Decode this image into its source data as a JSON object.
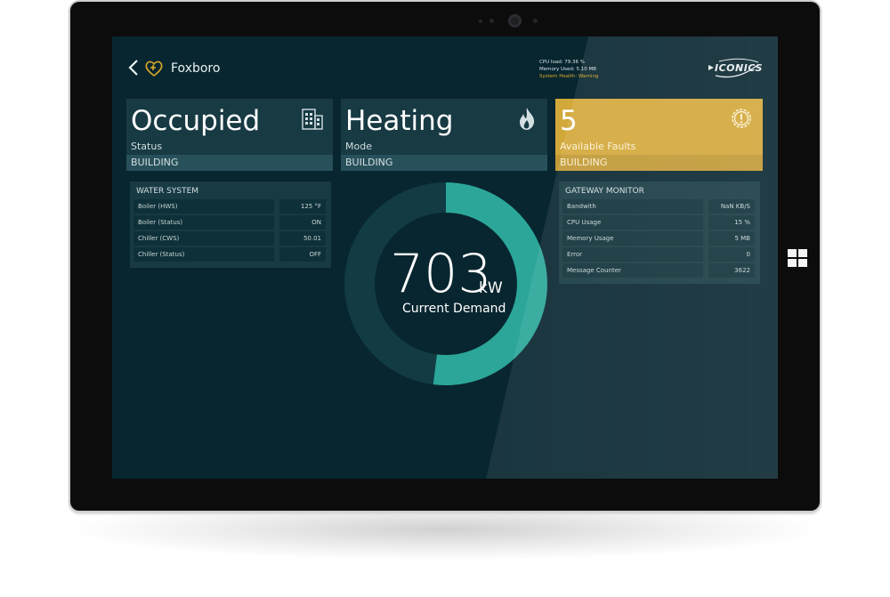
{
  "app": {
    "site": "Foxboro",
    "logo_text": "ICONICS"
  },
  "system_status": {
    "cpu_load": "CPU load: 79.36 %",
    "memory_used": "Memory Used: 5.10 MB",
    "health": "System Health: Warning"
  },
  "cards": [
    {
      "value": "Occupied",
      "label": "Status",
      "tag": "BUILDING",
      "icon": "building-icon"
    },
    {
      "value": "Heating",
      "label": "Mode",
      "tag": "BUILDING",
      "icon": "flame-icon"
    },
    {
      "value": "5",
      "label": "Available Faults",
      "tag": "BUILDING",
      "icon": "warning-gear-icon"
    }
  ],
  "water_system": {
    "title": "WATER SYSTEM",
    "rows": [
      {
        "label": "Boiler (HWS)",
        "value": "125 °F"
      },
      {
        "label": "Boiler (Status)",
        "value": "ON"
      },
      {
        "label": "Chiller (CWS)",
        "value": "50.01"
      },
      {
        "label": "Chiller (Status)",
        "value": "OFF"
      }
    ]
  },
  "gateway_monitor": {
    "title": "GATEWAY MONITOR",
    "rows": [
      {
        "label": "Bandwith",
        "value": "NaN KB/S"
      },
      {
        "label": "CPU Usage",
        "value": "15 %"
      },
      {
        "label": "Memory Usage",
        "value": "5 MB"
      },
      {
        "label": "Error",
        "value": "0"
      },
      {
        "label": "Message Counter",
        "value": "3622"
      }
    ]
  },
  "demand": {
    "value": "703",
    "unit": "kW",
    "label": "Current Demand",
    "fill_fraction": 0.52
  },
  "colors": {
    "screen_bg": "#08262f",
    "card_bg": "#173a43",
    "alert": "#d3a83b",
    "gauge_fill": "#2ba699",
    "gauge_track": "#123b44"
  }
}
